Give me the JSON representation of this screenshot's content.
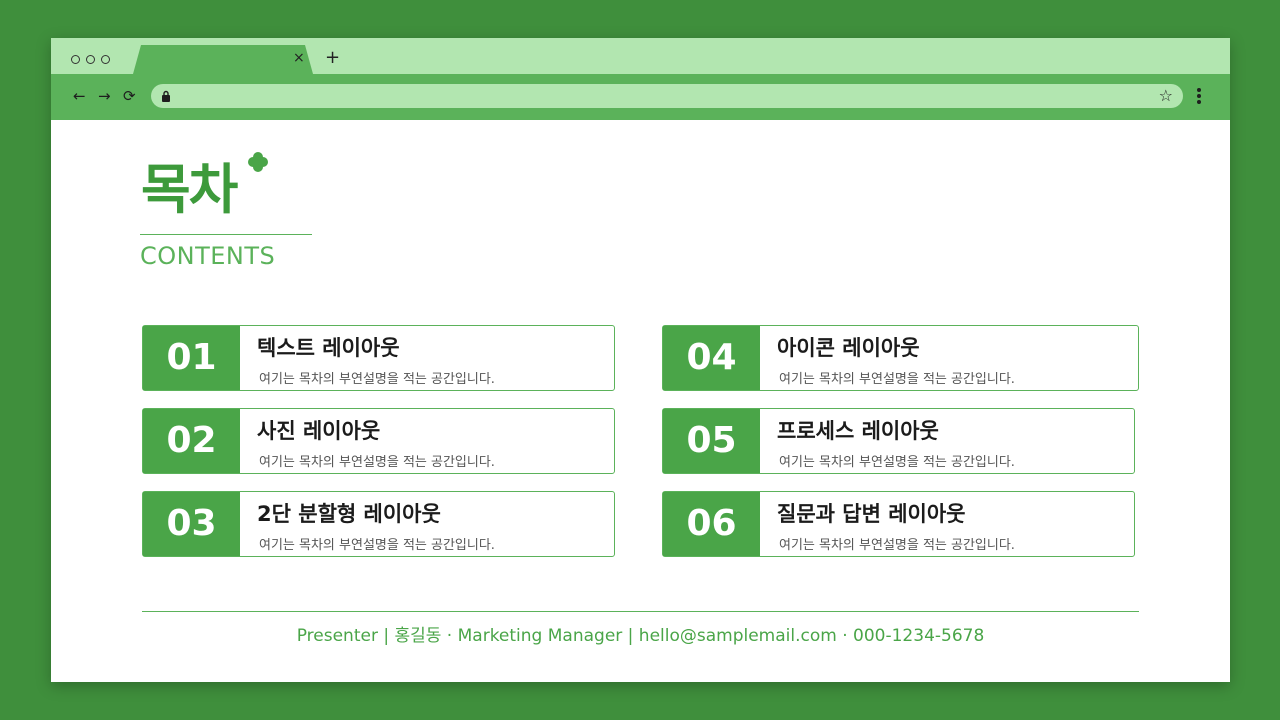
{
  "browser": {
    "new_tab_symbol": "+",
    "close_symbol": "×",
    "back_symbol": "←",
    "forward_symbol": "→",
    "reload_symbol": "⟳",
    "bookmark_symbol": "☆"
  },
  "colors": {
    "background": "#3f8f3c",
    "accent": "#4aa548",
    "tab_strip": "#b2e6b0",
    "toolbar": "#5bb25a"
  },
  "slide": {
    "title": "목차",
    "subtitle": "CONTENTS",
    "items": [
      {
        "number": "01",
        "title": "텍스트 레이아웃",
        "description": "여기는 목차의 부연설명을 적는 공간입니다."
      },
      {
        "number": "02",
        "title": "사진 레이아웃",
        "description": "여기는 목차의 부연설명을 적는 공간입니다."
      },
      {
        "number": "03",
        "title": "2단 분할형 레이아웃",
        "description": "여기는 목차의 부연설명을 적는 공간입니다."
      },
      {
        "number": "04",
        "title": "아이콘 레이아웃",
        "description": "여기는 목차의 부연설명을 적는 공간입니다."
      },
      {
        "number": "05",
        "title": "프로세스 레이아웃",
        "description": "여기는 목차의 부연설명을 적는 공간입니다."
      },
      {
        "number": "06",
        "title": "질문과 답변 레이아웃",
        "description": "여기는 목차의 부연설명을 적는 공간입니다."
      }
    ],
    "footer": "Presenter | 홍길동 · Marketing Manager | hello@samplemail.com · 000-1234-5678"
  }
}
